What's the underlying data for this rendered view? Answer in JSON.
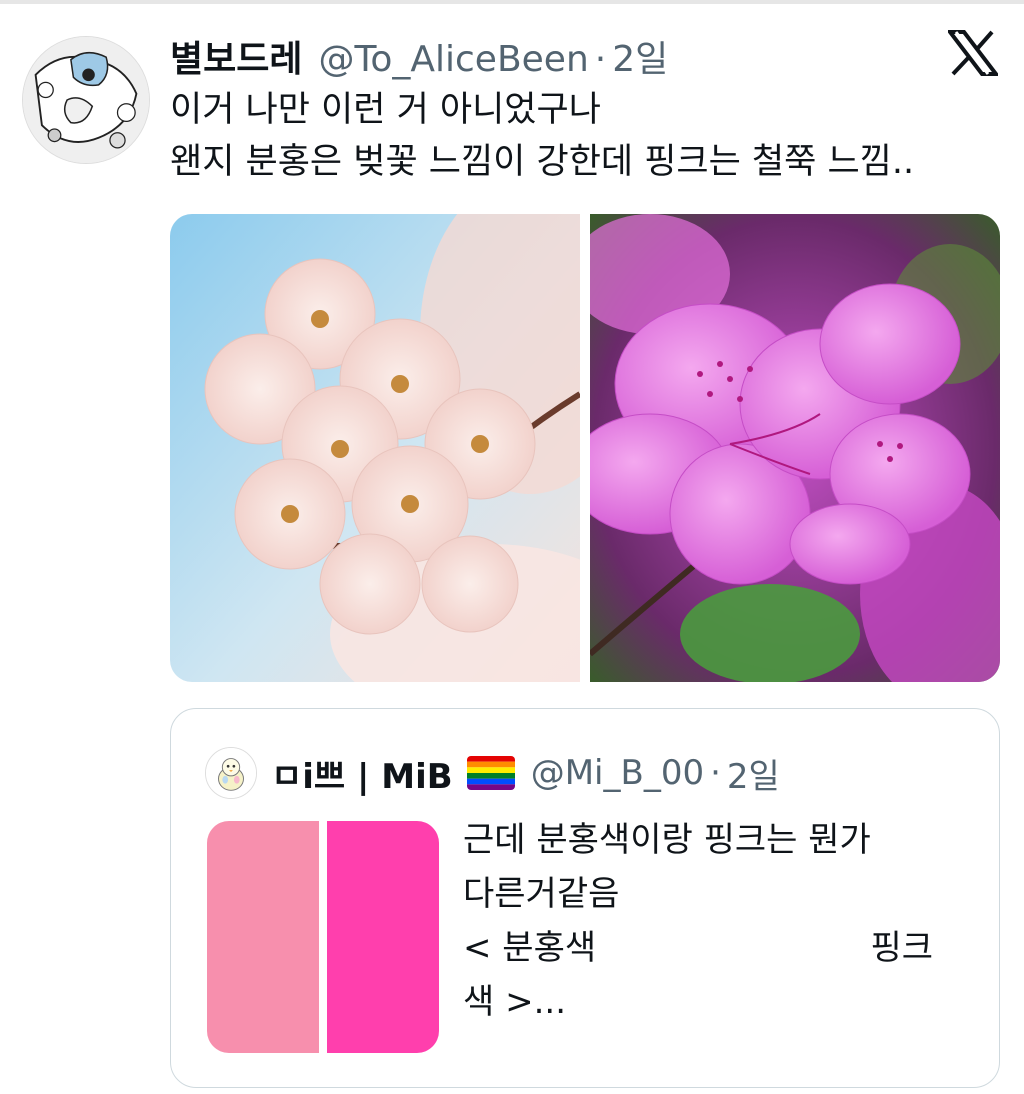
{
  "tweet": {
    "author_name": "별보드레",
    "handle": "@To_AliceBeen",
    "separator": "·",
    "time": "2일",
    "lines": [
      "이거 나만 이런 거 아니었구나",
      "왠지 분홍은 벚꽃 느낌이 강한데 핑크는 철쭉 느낌.."
    ],
    "media": [
      {
        "name": "cherry-blossom-photo",
        "sky": "#9fd0ea",
        "petal": "#f6dcd8"
      },
      {
        "name": "azalea-photo",
        "petal": "#e97ce6",
        "leaf": "#3f8a3a"
      }
    ]
  },
  "quote": {
    "author_name": "ㅁi쁘 | MiB",
    "flag_icon": "rainbow-flag",
    "handle": "@Mi_B_00",
    "separator": "·",
    "time": "2일",
    "line1": "근데 분홍색이랑 핑크는 뭔가",
    "line2": "다른거같음",
    "line3_left": "<  분홍색",
    "line3_right": "핑크",
    "line4": "색  >...",
    "swatches": {
      "bunhong": "#f78fad",
      "pink": "#ff3fad"
    }
  },
  "icons": {
    "platform_logo": "x-logo"
  }
}
